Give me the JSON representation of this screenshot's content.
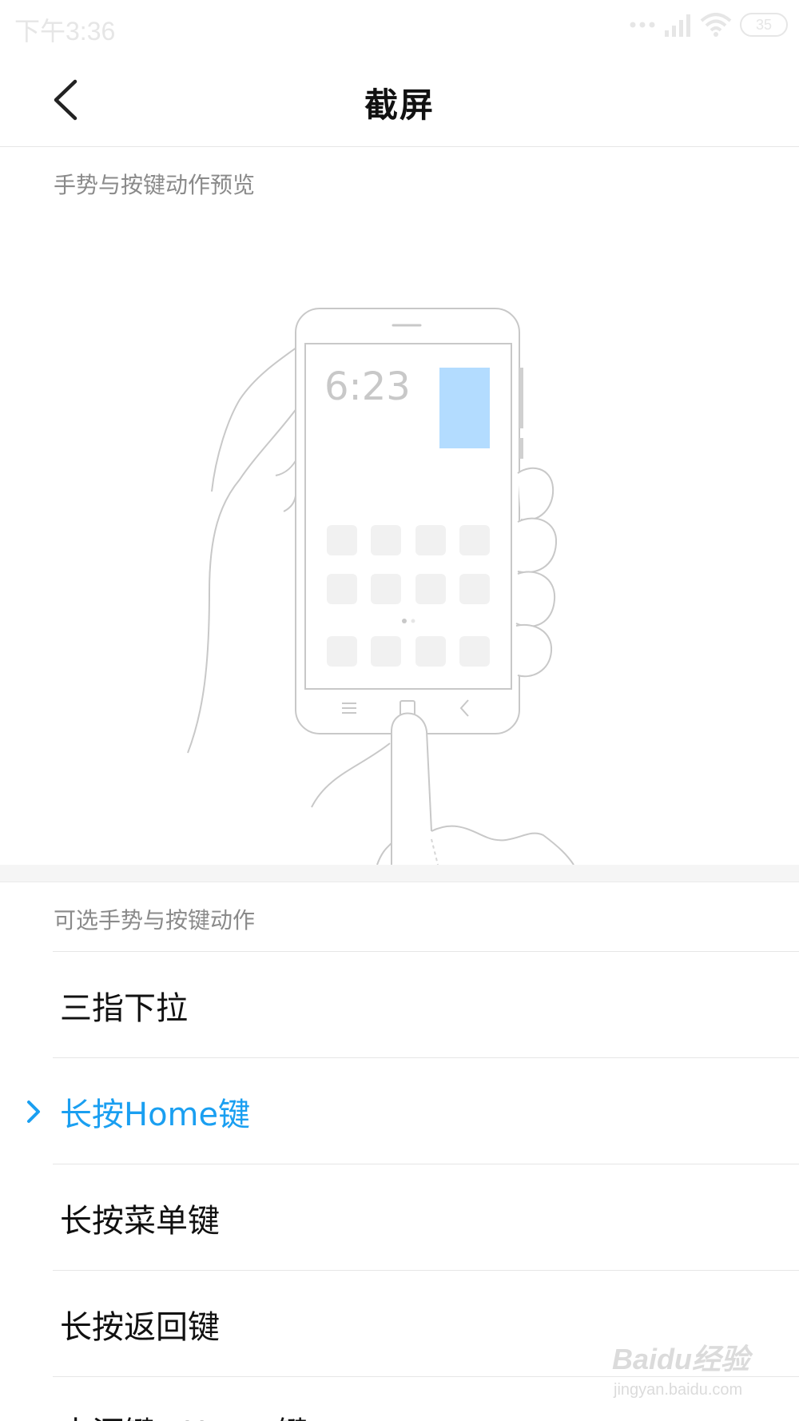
{
  "status_bar": {
    "time": "下午3:36",
    "battery": "35"
  },
  "header": {
    "title": "截屏"
  },
  "preview_section": {
    "heading": "手势与按键动作预览",
    "clock": "6:23"
  },
  "options_section": {
    "heading": "可选手势与按键动作",
    "options": [
      {
        "label": "三指下拉",
        "selected": false
      },
      {
        "label": "长按Home键",
        "selected": true
      },
      {
        "label": "长按菜单键",
        "selected": false
      },
      {
        "label": "长按返回键",
        "selected": false
      },
      {
        "label": "电源键+Home键",
        "selected": false
      }
    ]
  },
  "colors": {
    "accent": "#1a9ff1",
    "preview_highlight": "#b3dcff"
  },
  "watermark": {
    "text": "Baidu经验",
    "url": "jingyan.baidu.com"
  }
}
